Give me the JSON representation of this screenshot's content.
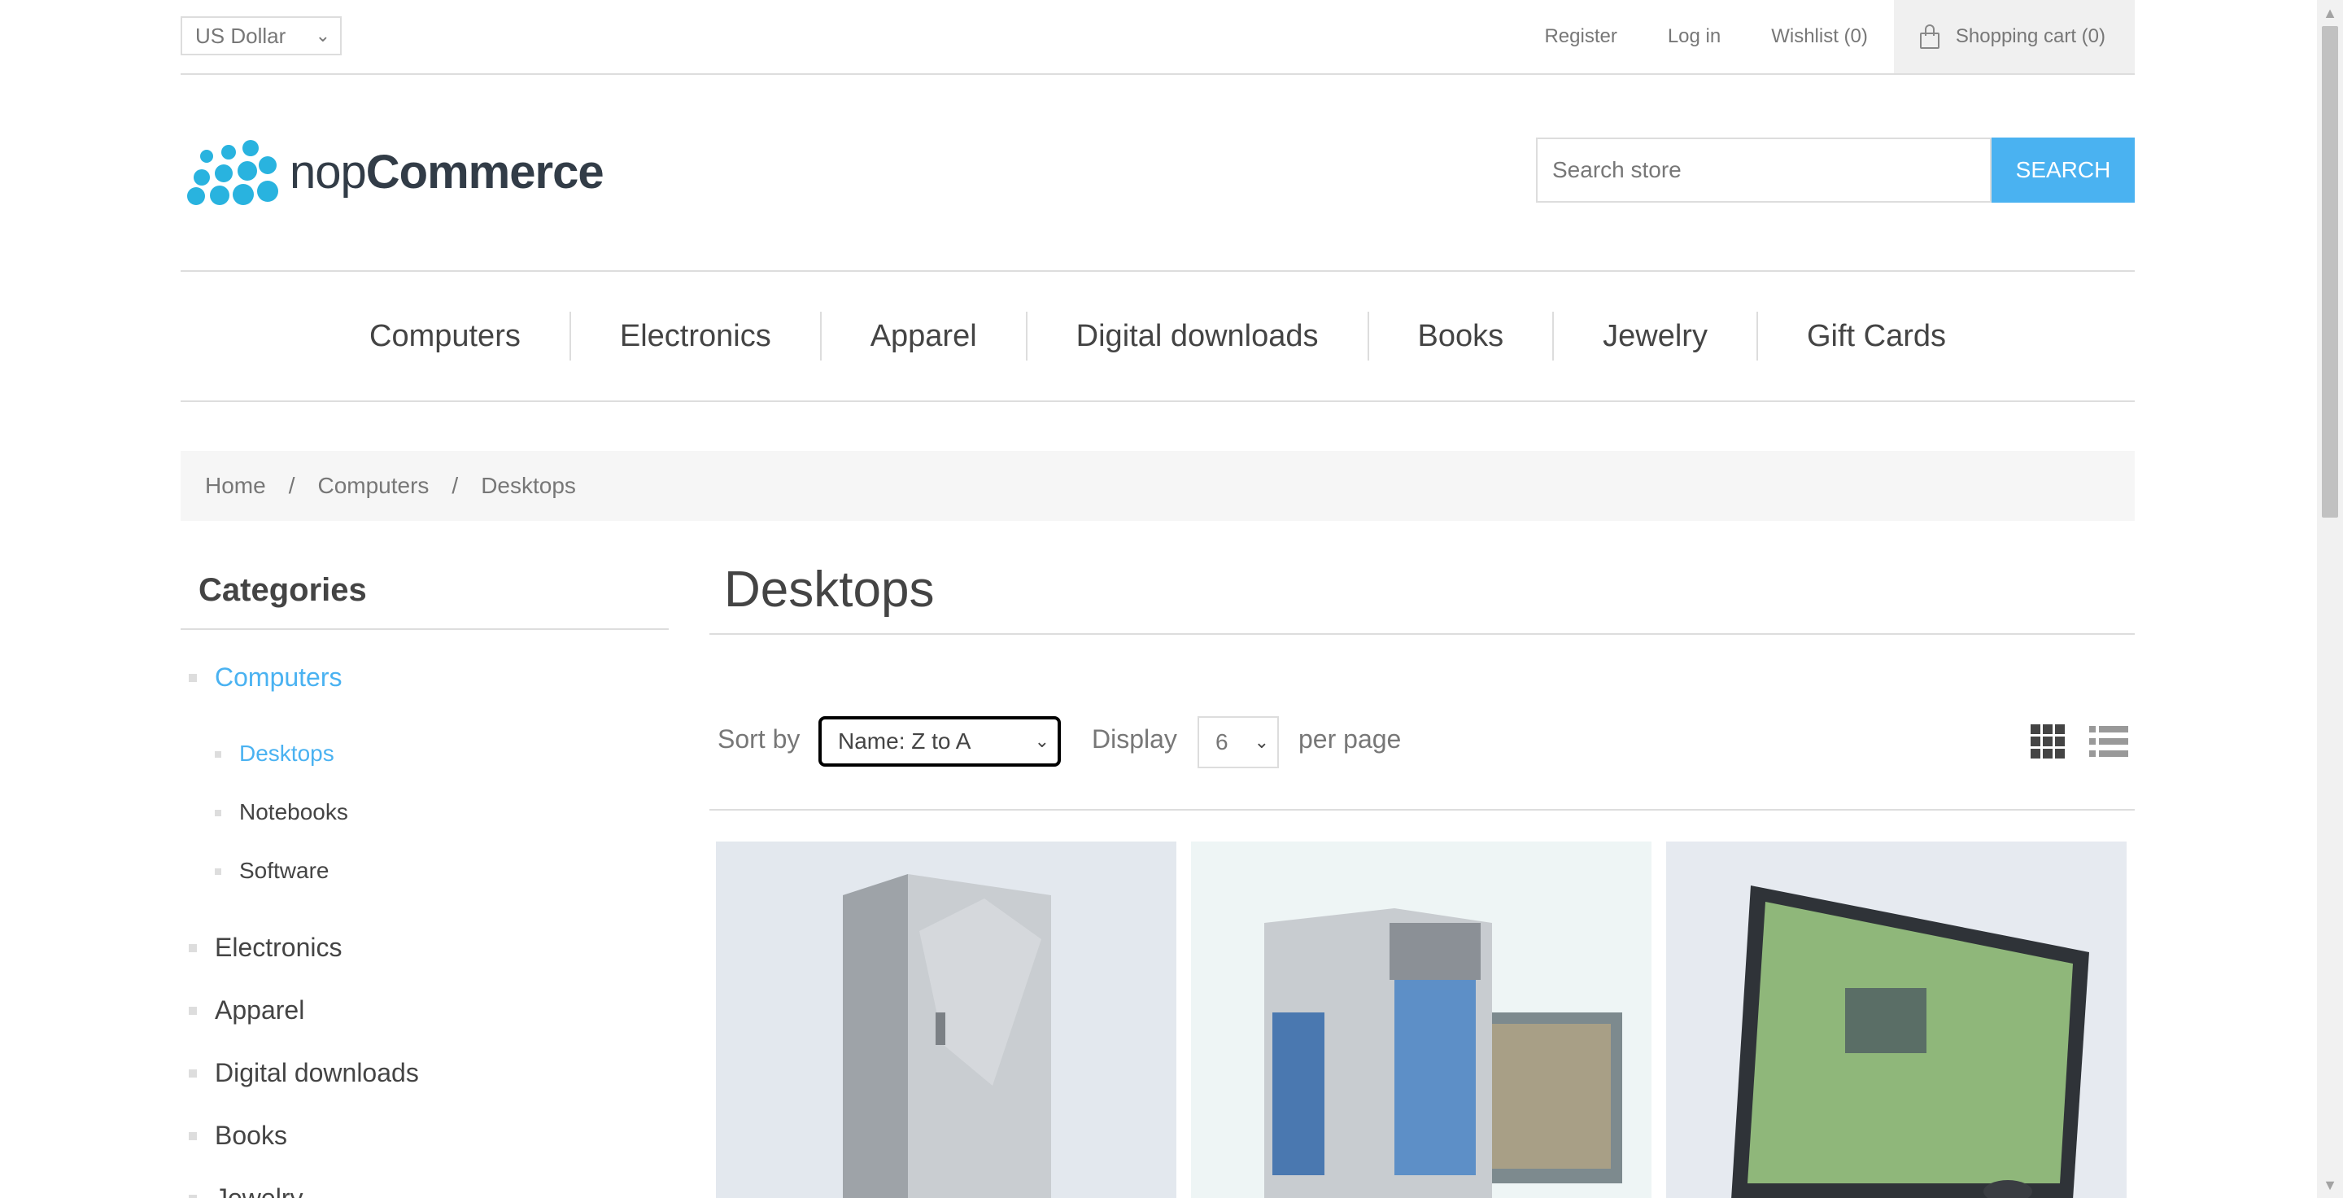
{
  "header": {
    "currency": "US Dollar",
    "links": {
      "register": "Register",
      "login": "Log in",
      "wishlist": "Wishlist (0)",
      "cart": "Shopping cart (0)"
    }
  },
  "logo": {
    "text_light": "nop",
    "text_bold": "Commerce"
  },
  "search": {
    "placeholder": "Search store",
    "button": "SEARCH"
  },
  "nav": [
    "Computers",
    "Electronics",
    "Apparel",
    "Digital downloads",
    "Books",
    "Jewelry",
    "Gift Cards"
  ],
  "breadcrumb": {
    "home": "Home",
    "sep": "/",
    "parent": "Computers",
    "current": "Desktops"
  },
  "sidebar": {
    "title": "Categories",
    "categories": [
      {
        "label": "Computers",
        "active": true
      },
      {
        "label": "Desktops",
        "active": true,
        "sub": true
      },
      {
        "label": "Notebooks",
        "sub": true
      },
      {
        "label": "Software",
        "sub": true
      },
      {
        "label": "Electronics"
      },
      {
        "label": "Apparel"
      },
      {
        "label": "Digital downloads"
      },
      {
        "label": "Books"
      },
      {
        "label": "Jewelry"
      }
    ]
  },
  "main": {
    "title": "Desktops",
    "sort_label": "Sort by",
    "sort_value": "Name: Z to A",
    "display_label": "Display",
    "display_value": "6",
    "per_page": "per page"
  },
  "colors": {
    "accent": "#4ab2f1",
    "logo_blue": "#29b3df"
  }
}
